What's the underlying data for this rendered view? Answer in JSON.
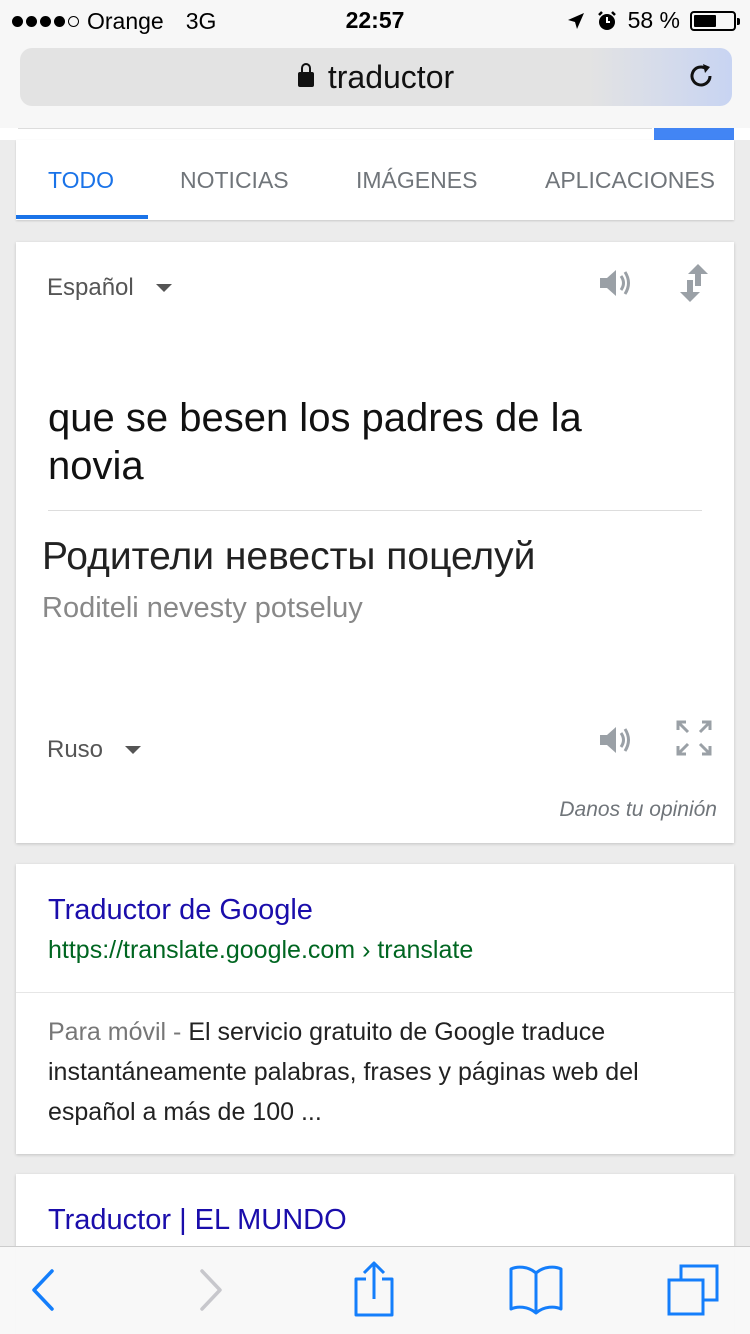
{
  "status_bar": {
    "carrier": "Orange",
    "network": "3G",
    "time": "22:57",
    "battery": "58 %",
    "battery_level": 0.58
  },
  "browser": {
    "url": "traductor"
  },
  "tabs": [
    "TODO",
    "NOTICIAS",
    "IMÁGENES",
    "APLICACIONES"
  ],
  "translate": {
    "source_lang": "Español",
    "source_text": "que se besen los padres de la novia",
    "target_text": "Родители невесты поцелуй",
    "transliteration": "Roditeli nevesty potseluy",
    "target_lang": "Ruso",
    "feedback": "Danos tu opinión"
  },
  "results": [
    {
      "title": "Traductor de Google",
      "url": "https://translate.google.com › translate",
      "snippet_label": "Para móvil - ",
      "snippet": "El servicio gratuito de Google traduce instantáneamente palabras, frases y páginas web del español a más de 100 ..."
    },
    {
      "title": "Traductor | EL MUNDO"
    }
  ],
  "colors": {
    "accent": "#1a73e8",
    "link": "#1a0dab",
    "url_green": "#006621",
    "ios_blue": "#147efb"
  }
}
